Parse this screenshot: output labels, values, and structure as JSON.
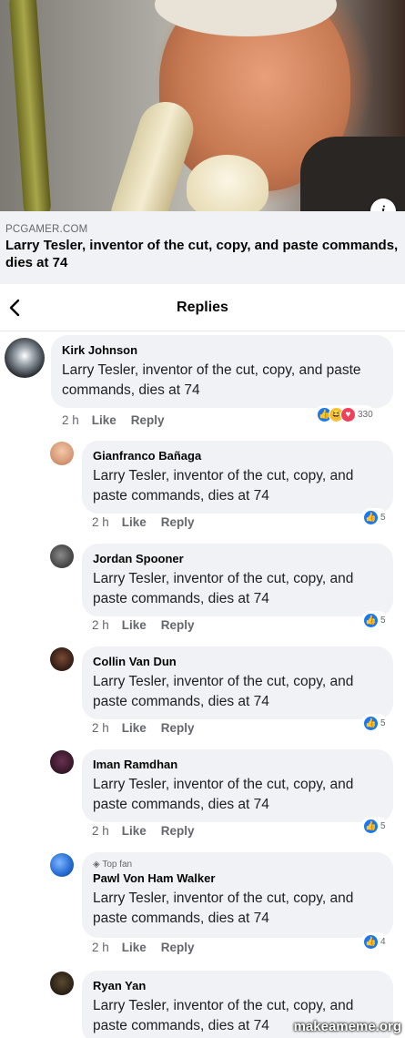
{
  "preview": {
    "source": "PCGAMER.COM",
    "headline": "Larry Tesler, inventor of the cut, copy, and paste commands, dies at 74",
    "info_icon": "info-icon"
  },
  "header": {
    "title": "Replies",
    "back_icon": "chevron-left-icon"
  },
  "actions": {
    "like": "Like",
    "reply": "Reply"
  },
  "comments": [
    {
      "author": "Kirk Johnson",
      "text": "Larry Tesler, inventor of the cut, copy, and paste commands, dies at 74",
      "time": "2 h",
      "reactions": [
        "like",
        "haha",
        "love"
      ],
      "reaction_count": "330"
    },
    {
      "author": "Gianfranco Bañaga",
      "text": "Larry Tesler, inventor of the cut, copy, and paste commands, dies at 74",
      "time": "2 h",
      "reactions": [
        "like"
      ],
      "reaction_count": "5"
    },
    {
      "author": "Jordan Spooner",
      "text": "Larry Tesler, inventor of the cut, copy, and paste commands, dies at 74",
      "time": "2 h",
      "reactions": [
        "like"
      ],
      "reaction_count": "5"
    },
    {
      "author": "Collin Van Dun",
      "text": "Larry Tesler, inventor of the cut, copy, and paste commands, dies at 74",
      "time": "2 h",
      "reactions": [
        "like"
      ],
      "reaction_count": "5"
    },
    {
      "author": "Iman Ramdhan",
      "text": "Larry Tesler, inventor of the cut, copy, and paste commands, dies at 74",
      "time": "2 h",
      "reactions": [
        "like"
      ],
      "reaction_count": "5"
    },
    {
      "badge": "Top fan",
      "author": "Pawl Von Ham Walker",
      "text": "Larry Tesler, inventor of the cut, copy, and paste commands, dies at 74",
      "time": "2 h",
      "reactions": [
        "like"
      ],
      "reaction_count": "4"
    },
    {
      "author": "Ryan Yan",
      "text": "Larry Tesler, inventor of the cut, copy, and paste commands, dies at 74"
    }
  ],
  "watermark": "makeameme.org",
  "colors": {
    "bubble": "#f0f2f5",
    "like_blue": "#1877f2",
    "muted_text": "#65676b"
  }
}
